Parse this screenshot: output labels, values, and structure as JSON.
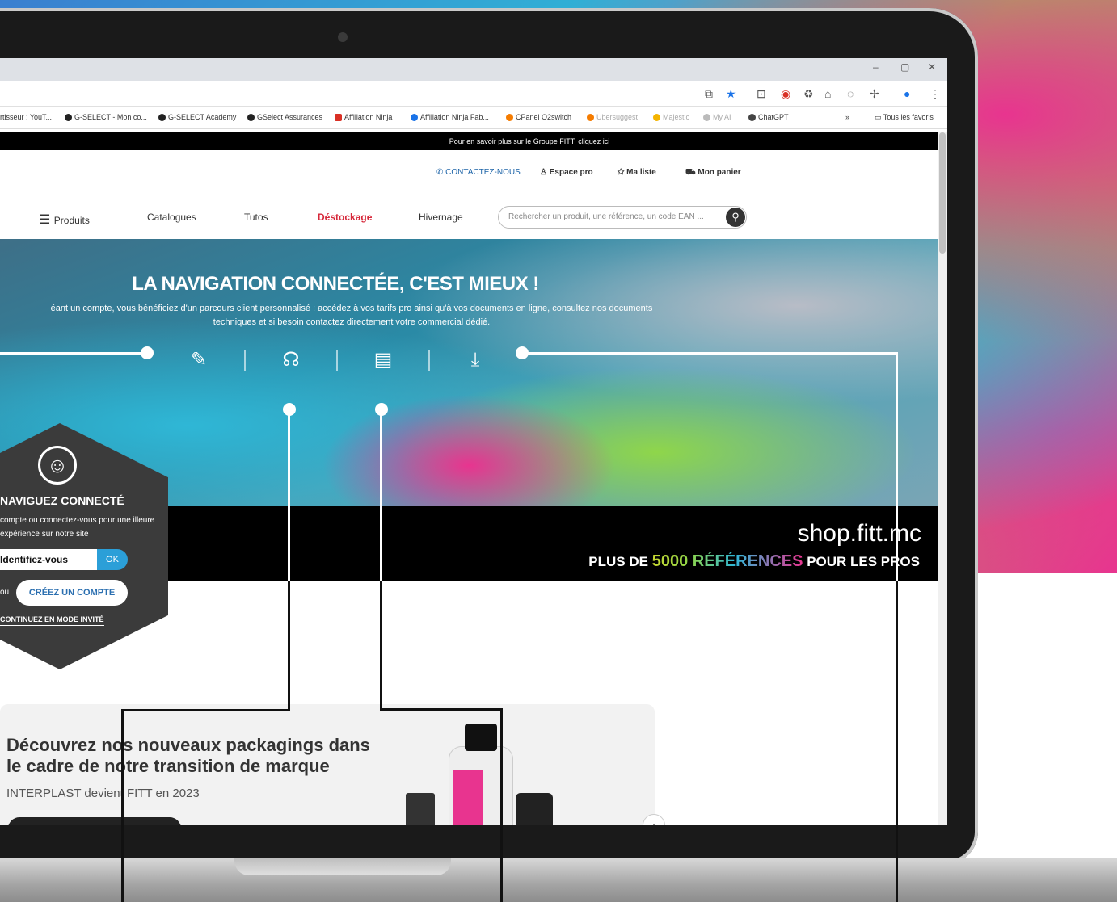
{
  "browser": {
    "window_controls": [
      "–",
      "▢",
      "✕"
    ],
    "bookmarks": [
      {
        "label": "rtisseur : YouT...",
        "color": "#e62117"
      },
      {
        "label": "G-SELECT - Mon co...",
        "color": "#222222"
      },
      {
        "label": "G-SELECT Academy",
        "color": "#222222"
      },
      {
        "label": "GSelect Assurances",
        "color": "#222222"
      },
      {
        "label": "Affiliation Ninja",
        "color": "#d93025"
      },
      {
        "label": "Affiliation Ninja Fab...",
        "color": "#1a73e8"
      },
      {
        "label": "CPanel O2switch",
        "color": "#f57c00"
      },
      {
        "label": "Ubersuggest",
        "color": "#f57c00"
      },
      {
        "label": "Majestic",
        "color": "#f4b400"
      },
      {
        "label": "My AI",
        "color": "#888888"
      },
      {
        "label": "ChatGPT",
        "color": "#444444"
      }
    ],
    "all_bookmarks": "Tous les favoris",
    "more_bookmarks": "»"
  },
  "site": {
    "promo": "Pour en savoir plus sur le Groupe FITT, cliquez ici",
    "top_nav": {
      "contact": "CONTACTEZ-NOUS",
      "pro_space": "Espace pro",
      "wishlist": "Ma liste",
      "cart": "Mon panier"
    },
    "main_nav": {
      "products": "Produits",
      "catalogs": "Catalogues",
      "tutorials": "Tutos",
      "clearance": "Déstockage",
      "winterizing": "Hivernage"
    },
    "search_placeholder": "Rechercher un produit, une référence, un code EAN ...",
    "hero": {
      "title": "LA NAVIGATION CONNECTÉE, C'EST MIEUX !",
      "desc_line1": "éant un compte, vous bénéficiez d'un parcours client personnalisé : accédez à vos tarifs pro ainsi qu'à vos documents en ligne, consultez nos documents",
      "desc_line2": "techniques et si besoin contactez directement votre commercial dédié."
    },
    "banner": {
      "url": "shop.fitt.mc",
      "refs_pre": "PLUS DE",
      "refs_highlight": "5000 RÉFÉRENCES",
      "refs_post": "POUR LES PROS"
    },
    "login": {
      "title": "NAVIGUEZ CONNECTÉ",
      "desc": "compte ou connectez-vous pour une illeure expérience sur notre site",
      "input": "Identifiez-vous",
      "ok": "OK",
      "or": "ou",
      "create": "CRÉEZ UN COMPTE",
      "guest": "CONTINUEZ EN MODE INVITÉ"
    },
    "card": {
      "title": "Découvrez nos nouveaux packagings dans le cadre de notre transition de marque",
      "subtitle": "INTERPLAST devient FITT en 2023"
    }
  }
}
